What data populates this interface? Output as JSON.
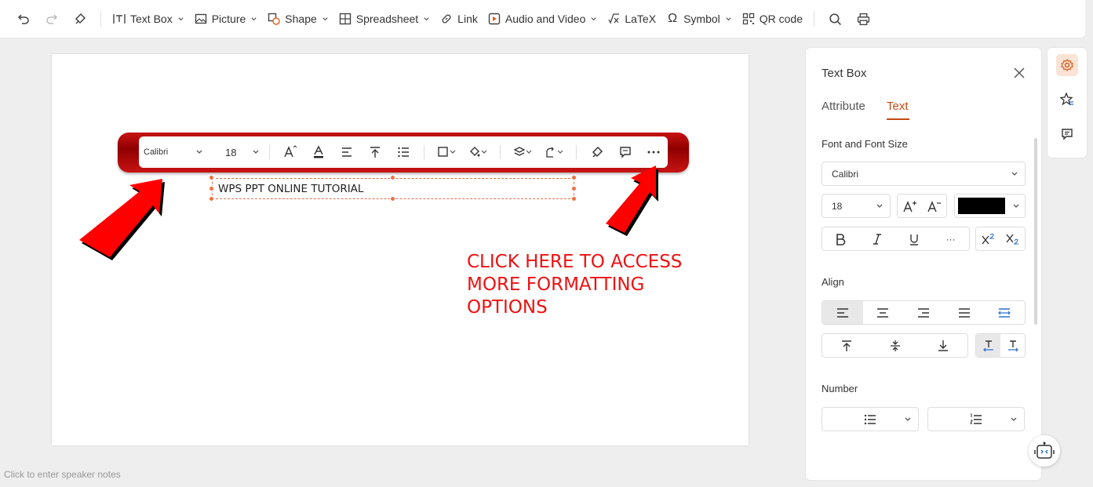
{
  "toolbar": {
    "text_box": "Text Box",
    "picture": "Picture",
    "shape": "Shape",
    "spreadsheet": "Spreadsheet",
    "link": "Link",
    "audio_video": "Audio and Video",
    "latex": "LaTeX",
    "symbol": "Symbol",
    "qr_code": "QR code"
  },
  "floating_toolbar": {
    "font": "Calibri",
    "size": "18"
  },
  "slide": {
    "textbox_text": "WPS PPT ONLINE TUTORIAL",
    "callout_lines": [
      "CLICK HERE TO ACCESS",
      "MORE FORMATTING",
      "OPTIONS"
    ],
    "arrow_color": "#ff0000",
    "band_color": "#b30000"
  },
  "notes_placeholder": "Click to enter speaker notes",
  "panel": {
    "title": "Text Box",
    "tabs": [
      "Attribute",
      "Text"
    ],
    "active_tab": "Text",
    "font_section": "Font and Font Size",
    "font": "Calibri",
    "size": "18",
    "font_color": "#000000",
    "more": "···",
    "align_section": "Align",
    "number_section": "Number",
    "accent": "#c44b12"
  }
}
